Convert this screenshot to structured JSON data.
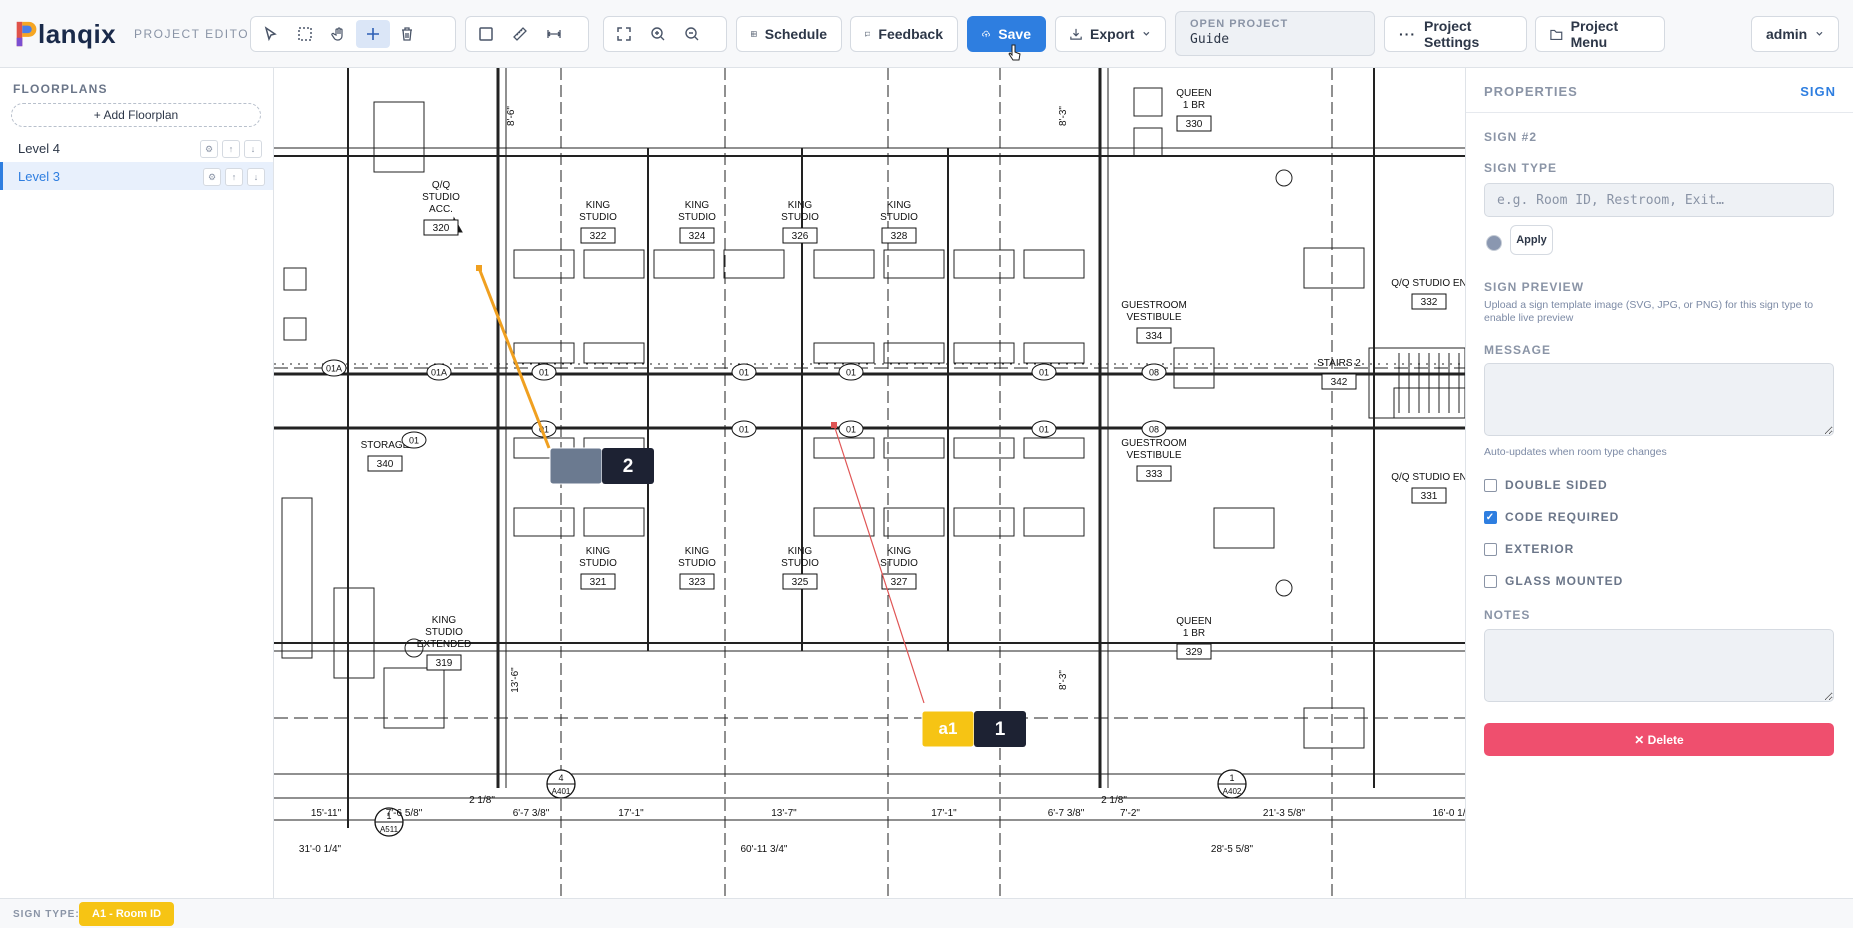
{
  "app": {
    "logo_text": "lanqix",
    "editor_label": "PROJECT EDITOR"
  },
  "toolbar": {
    "schedule": "Schedule",
    "feedback": "Feedback",
    "save": "Save",
    "export": "Export",
    "open_project_label": "OPEN PROJECT",
    "open_project_value": "Guide",
    "project_settings": "Project Settings",
    "project_menu": "Project Menu",
    "user": "admin"
  },
  "sidebar": {
    "title": "FLOORPLANS",
    "add_label": "+ Add Floorplan",
    "items": [
      {
        "label": "Level 4"
      },
      {
        "label": "Level 3"
      }
    ],
    "active_index": 1
  },
  "canvas": {
    "rooms": [
      {
        "label": "KING\nSTUDIO",
        "num": "322"
      },
      {
        "label": "KING\nSTUDIO",
        "num": "324"
      },
      {
        "label": "KING\nSTUDIO",
        "num": "326"
      },
      {
        "label": "KING\nSTUDIO",
        "num": "328"
      },
      {
        "label": "KING\nSTUDIO",
        "num": "321"
      },
      {
        "label": "KING\nSTUDIO",
        "num": "323"
      },
      {
        "label": "KING\nSTUDIO",
        "num": "325"
      },
      {
        "label": "KING\nSTUDIO",
        "num": "327"
      },
      {
        "label": "Q/Q\nSTUDIO\nACC.",
        "num": "320"
      },
      {
        "label": "STORAGE",
        "num": "340"
      },
      {
        "label": "KING\nSTUDIO\nEXTENDED",
        "num": "319"
      },
      {
        "label": "QUEEN\n1 BR",
        "num": "330"
      },
      {
        "label": "QUEEN\n1 BR",
        "num": "329"
      },
      {
        "label": "GUESTROOM\nVESTIBULE",
        "num": "334"
      },
      {
        "label": "GUESTROOM\nVESTIBULE",
        "num": "333"
      },
      {
        "label": "STAIRS 2",
        "num": "342"
      },
      {
        "label": "Q/Q STUDIO EN",
        "num": "332"
      },
      {
        "label": "Q/Q STUDIO EN",
        "num": "331"
      }
    ],
    "dimensions": [
      "15'-11\"",
      "7'-6 5/8\"",
      "6'-7 3/8\"",
      "17'-1\"",
      "13'-7\"",
      "17'-1\"",
      "6'-7 3/8\"",
      "7'-2\"",
      "21'-3 5/8\"",
      "16'-0 1/",
      "31'-0 1/4\"",
      "60'-11 3/4\"",
      "28'-5 5/8\"",
      "2 1/8\"",
      "2 1/8\"",
      "13'-6\"",
      "8'-6\"",
      "8'-3\"",
      "8'-3\""
    ],
    "sections": [
      {
        "num": "4",
        "sheet": "A401"
      },
      {
        "num": "1",
        "sheet": "A402"
      },
      {
        "num": "1",
        "sheet": "A511"
      }
    ],
    "signs": [
      {
        "code": "a1",
        "number": "1",
        "color": "#f6c414"
      },
      {
        "code": "",
        "number": "2",
        "color": "#6b7a90"
      }
    ]
  },
  "properties": {
    "header": "PROPERTIES",
    "kind": "SIGN",
    "sign_id": "SIGN #2",
    "sign_type_label": "SIGN TYPE",
    "sign_type_placeholder": "e.g. Room ID, Restroom, Exit…",
    "apply": "Apply",
    "preview_label": "SIGN PREVIEW",
    "preview_help": "Upload a sign template image (SVG, JPG, or PNG) for this sign type to enable live preview",
    "message_label": "MESSAGE",
    "message_help": "Auto-updates when room type changes",
    "checks": [
      {
        "label": "DOUBLE SIDED",
        "checked": false
      },
      {
        "label": "CODE REQUIRED",
        "checked": true
      },
      {
        "label": "EXTERIOR",
        "checked": false
      },
      {
        "label": "GLASS MOUNTED",
        "checked": false
      }
    ],
    "notes_label": "NOTES",
    "delete": "✕ Delete"
  },
  "status": {
    "label": "SIGN TYPE:",
    "chip": "A1 - Room ID",
    "chip_color": "#f6c414"
  }
}
